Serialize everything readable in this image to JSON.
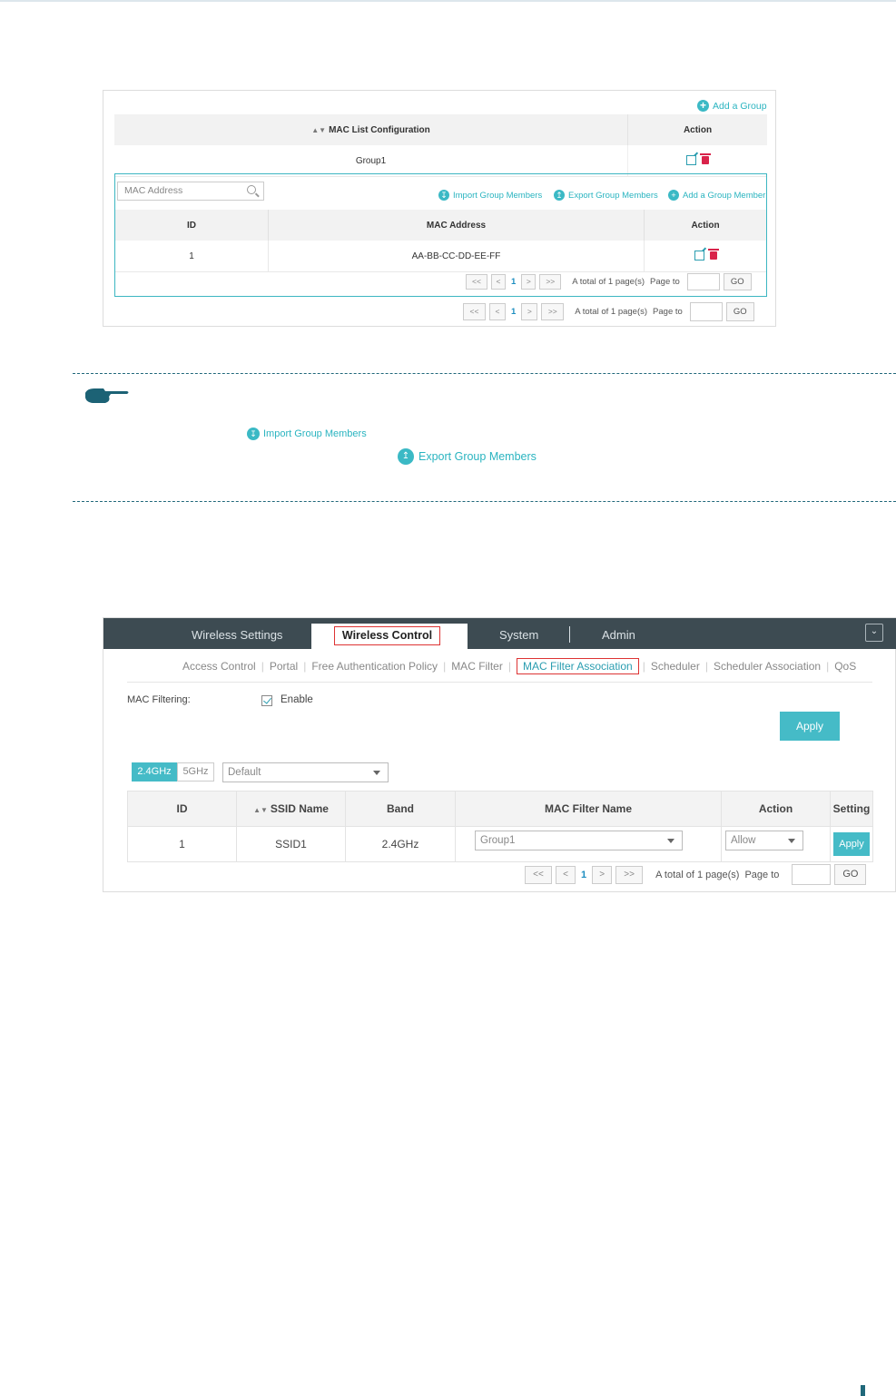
{
  "shot1": {
    "add_group": "Add a Group",
    "table_headers": [
      "MAC List Configuration",
      "Action"
    ],
    "group_name": "Group1",
    "search_placeholder": "MAC Address",
    "toolbar": {
      "import": "Import Group Members",
      "export": "Export Group Members",
      "add_member": "Add a Group Member"
    },
    "inner_headers": [
      "ID",
      "MAC Address",
      "Action"
    ],
    "inner_rows": [
      {
        "id": "1",
        "mac": "AA-BB-CC-DD-EE-FF"
      }
    ],
    "pager": {
      "first": "<<",
      "prev": "<",
      "page": "1",
      "next": ">",
      "last": ">>",
      "total": "A total of 1 page(s)",
      "page_to": "Page to",
      "go": "GO"
    }
  },
  "note": {
    "import_label": "Import Group Members",
    "export_label": "Export Group Members"
  },
  "shot2": {
    "nav": [
      "Wireless Settings",
      "Wireless Control",
      "System",
      "Admin"
    ],
    "subnav": [
      "Access Control",
      "Portal",
      "Free Authentication Policy",
      "MAC Filter",
      "MAC Filter Association",
      "Scheduler",
      "Scheduler Association",
      "QoS"
    ],
    "mac_filtering_label": "MAC Filtering:",
    "enable_label": "Enable",
    "apply": "Apply",
    "band_tabs": [
      "2.4GHz",
      "5GHz"
    ],
    "ssid_select": "Default",
    "table_headers": [
      "ID",
      "SSID Name",
      "Band",
      "MAC Filter Name",
      "Action",
      "Setting"
    ],
    "rows": [
      {
        "id": "1",
        "ssid": "SSID1",
        "band": "2.4GHz",
        "filter": "Group1",
        "action": "Allow",
        "setting": "Apply"
      }
    ],
    "pager": {
      "first": "<<",
      "prev": "<",
      "page": "1",
      "next": ">",
      "last": ">>",
      "total": "A total of 1 page(s)",
      "page_to": "Page to",
      "go": "GO"
    }
  },
  "colors": {
    "accent": "#45bbc7",
    "highlight": "#dd3333",
    "nav_bg": "#3d4b52",
    "note_dash": "#20687a"
  }
}
